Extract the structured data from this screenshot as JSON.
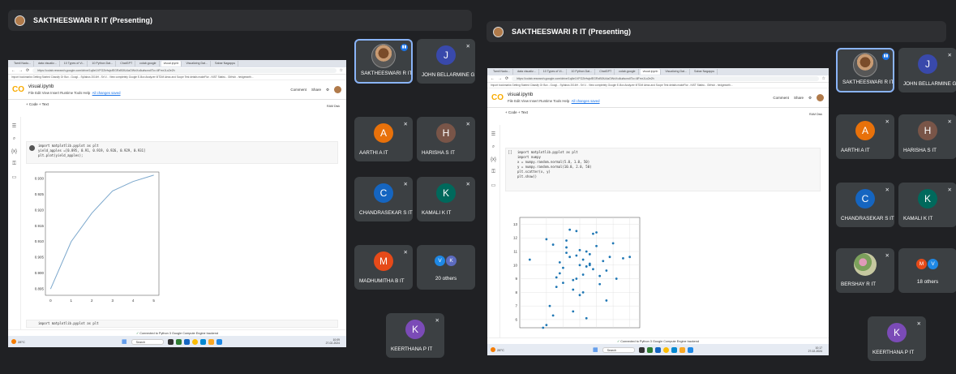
{
  "left": {
    "presenter_bar": "SAKTHEESWARI R IT (Presenting)",
    "browser_tabs": [
      "Tamil Nadu...",
      "data visualiz...",
      "10 Types of Vi...",
      "10 Python Dat...",
      "ChatGPT",
      "colab.google",
      "visual.ipynb",
      "Visualizing Dat...",
      "Sabar Nagappu"
    ],
    "url": "https://colab.research.google.com/drive/1q6e1VFG2IrfwjsfEGRzB0lU4aOWxXu6u#scrollTo=4lFmrJLo2e2h",
    "bookmarks": "Import bookmarks   Getting Started   Classify Or Box - Googl...   Syllabus 2016H - Sri V...   View completely   Google   E-Box Analyzer   IIITDM Ainss and Scope   Test details   makeFlor - NIST Statist...   GitHub - hedgeearth...",
    "notebook_name": "visual.ipynb",
    "menus": "File  Edit  View  Insert  Runtime  Tools  Help",
    "saved_status": "All changes saved",
    "comment": "Comment",
    "share": "Share",
    "toolbar": "+ Code  + Text",
    "ram_disk": "RAM Disk",
    "code_lines": [
      "import matplotlib.pyplot as plt",
      "yield_apples =[0.895, 0.91, 0.919, 0.926, 0.929, 0.931]",
      "plt.plot(yield_apples);"
    ],
    "next_cell": "import matplotlib.pyplot as plt",
    "connected": "Connected to Python 3 Google Compute Engine backend",
    "weather": "28°C",
    "weather_desc": "Partly cloudy",
    "search": "Search",
    "time": "10:09",
    "date": "27-02-2024",
    "lang": "ENG IN",
    "others": "20 others"
  },
  "right": {
    "presenter_bar": "SAKTHEESWARI R IT (Presenting)",
    "code_lines": [
      "import matplotlib.pyplot as plt",
      "import numpy",
      "",
      "x = numpy.random.normal(5.0, 1.0, 50)",
      "y = numpy.random.normal(10.0, 2.0, 50)",
      "",
      "plt.scatter(x, y)",
      "plt.show()"
    ],
    "connected": "Connected to Python 3 Google Compute Engine backend",
    "weather": "28°C",
    "weather_desc": "Partly cloudy",
    "search": "Search",
    "time": "10:17",
    "date": "27-02-2024",
    "lang": "ENG IN",
    "others": "18 others"
  },
  "participants_left": [
    {
      "name": "SAKTHEESWARI R IT",
      "speaking": true
    },
    {
      "name": "JOHN BELLARMINE G...",
      "initial": "J",
      "color": "#3949ab"
    },
    {
      "name": "AARTHI A IT",
      "initial": "A",
      "color": "#e8710a"
    },
    {
      "name": "HARISHA S IT",
      "initial": "H",
      "color": "#795548"
    },
    {
      "name": "CHANDRASEKAR S IT",
      "initial": "C",
      "color": "#1565c0"
    },
    {
      "name": "KAMALI K IT",
      "initial": "K",
      "color": "#00695c"
    },
    {
      "name": "MADHUMITHA B IT",
      "initial": "M",
      "color": "#e64a19"
    },
    {
      "name": "KEERTHANA P IT",
      "initial": "K",
      "color": "#7b4bb7"
    }
  ],
  "participants_right": [
    {
      "name": "SAKTHEESWARI R IT",
      "speaking": true
    },
    {
      "name": "JOHN BELLARMINE G...",
      "initial": "J",
      "color": "#3949ab"
    },
    {
      "name": "AARTHI A IT",
      "initial": "A",
      "color": "#e8710a"
    },
    {
      "name": "HARISHA S IT",
      "initial": "H",
      "color": "#795548"
    },
    {
      "name": "CHANDRASEKAR S IT",
      "initial": "C",
      "color": "#1565c0"
    },
    {
      "name": "KAMALI K IT",
      "initial": "K",
      "color": "#00695c"
    },
    {
      "name": "BERSHAY R IT"
    },
    {
      "name": "KEERTHANA P IT",
      "initial": "K",
      "color": "#7b4bb7"
    }
  ],
  "others_avatars_left": [
    {
      "initial": "V",
      "color": "#1e88e5"
    },
    {
      "initial": "K",
      "color": "#5c6bc0"
    }
  ],
  "others_avatars_right": [
    {
      "initial": "M",
      "color": "#e64a19"
    },
    {
      "initial": "V",
      "color": "#1e88e5"
    }
  ],
  "chart_data": [
    {
      "type": "line",
      "x": [
        0,
        1,
        2,
        3,
        4,
        5
      ],
      "values": [
        0.895,
        0.91,
        0.919,
        0.926,
        0.929,
        0.931
      ],
      "xticks": [
        "0",
        "1",
        "2",
        "3",
        "4",
        "5"
      ],
      "yticks": [
        "0.895",
        "0.900",
        "0.905",
        "0.910",
        "0.915",
        "0.920",
        "0.925",
        "0.930"
      ],
      "ylim": [
        0.893,
        0.932
      ],
      "xlim": [
        -0.25,
        5.25
      ],
      "color": "#7ba7cc"
    },
    {
      "type": "scatter",
      "x": [
        3.5,
        4.0,
        4.2,
        4.4,
        4.5,
        4.6,
        4.7,
        4.8,
        4.9,
        5.0,
        5.1,
        5.2,
        5.3,
        5.5,
        5.6,
        5.8,
        6.0,
        6.3,
        4.1,
        4.3,
        4.6,
        4.8,
        5.0,
        5.2,
        5.4,
        5.7,
        4.4,
        4.9,
        5.1,
        5.5,
        6.1,
        4.7,
        5.3,
        4.2,
        3.9,
        5.0,
        5.9,
        4.5,
        5.6,
        6.5,
        4.8,
        5.1,
        5.4,
        4.6,
        5.8,
        4.3,
        5.2,
        4.0,
        4.9,
        5.3
      ],
      "y": [
        10.4,
        11.9,
        11.5,
        10.2,
        9.8,
        11.3,
        10.6,
        8.9,
        12.5,
        10.0,
        9.3,
        11.0,
        10.8,
        12.4,
        8.6,
        9.6,
        11.6,
        10.5,
        7.0,
        9.1,
        10.9,
        8.2,
        11.1,
        9.9,
        12.3,
        10.3,
        9.4,
        10.7,
        8.0,
        11.4,
        9.0,
        12.6,
        10.1,
        6.3,
        5.4,
        7.8,
        10.6,
        8.7,
        9.2,
        10.6,
        6.6,
        10.4,
        9.7,
        11.8,
        7.4,
        8.4,
        6.1,
        5.6,
        9.0,
        10.0
      ],
      "yticks": [
        "6",
        "7",
        "8",
        "9",
        "10",
        "11",
        "12",
        "13"
      ],
      "ylim": [
        5.4,
        13.5
      ],
      "xlim": [
        3.2,
        6.8
      ],
      "grid": true,
      "color": "#1f77b4"
    }
  ]
}
